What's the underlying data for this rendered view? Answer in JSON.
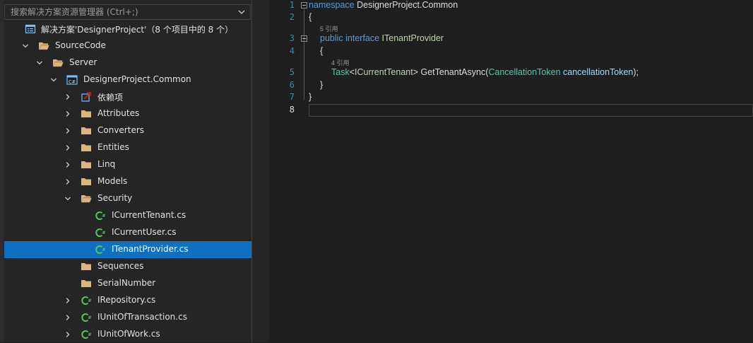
{
  "explorer": {
    "search_placeholder": "搜索解决方案资源管理器 (Ctrl+;)",
    "solution_label": "解决方案'DesignerProject'（8 个项目中的 8 个）",
    "items": [
      {
        "label": "SourceCode",
        "kind": "folder",
        "expanded": true
      },
      {
        "label": "Server",
        "kind": "folder",
        "expanded": true
      },
      {
        "label": "DesignerProject.Common",
        "kind": "csproj",
        "expanded": true
      },
      {
        "label": "依赖项",
        "kind": "dependencies",
        "expanded": false
      },
      {
        "label": "Attributes",
        "kind": "folder",
        "expanded": false
      },
      {
        "label": "Converters",
        "kind": "folder",
        "expanded": false
      },
      {
        "label": "Entities",
        "kind": "folder",
        "expanded": false
      },
      {
        "label": "Linq",
        "kind": "folder",
        "expanded": false
      },
      {
        "label": "Models",
        "kind": "folder",
        "expanded": false
      },
      {
        "label": "Security",
        "kind": "folder",
        "expanded": true
      },
      {
        "label": "ICurrentTenant.cs",
        "kind": "csfile"
      },
      {
        "label": "ICurrentUser.cs",
        "kind": "csfile"
      },
      {
        "label": "ITenantProvider.cs",
        "kind": "csfile",
        "selected": true
      },
      {
        "label": "Sequences",
        "kind": "folder"
      },
      {
        "label": "SerialNumber",
        "kind": "folder"
      },
      {
        "label": "IRepository.cs",
        "kind": "csfile",
        "expanded": false
      },
      {
        "label": "IUnitOfTransaction.cs",
        "kind": "csfile",
        "expanded": false
      },
      {
        "label": "IUnitOfWork.cs",
        "kind": "csfile",
        "expanded": false
      }
    ]
  },
  "editor": {
    "line_numbers": [
      "1",
      "2",
      "3",
      "4",
      "5",
      "6",
      "7",
      "8"
    ],
    "current_line": "8",
    "lines": {
      "l1_kw": "namespace",
      "l1_name": " DesignerProject.Common",
      "l2": "{",
      "l3_lens": "5 引用",
      "l3_kw": "public interface",
      "l3_name": " ITenantProvider",
      "l4": "{",
      "l5_lens": "4 引用",
      "l5_task": "Task",
      "l5_lt": "<",
      "l5_tenant": "ICurrentTenant",
      "l5_gt": ">",
      "l5_method": " GetTenantAsync(",
      "l5_ptype": "CancellationToken",
      "l5_pname": " cancellationToken",
      "l5_end": ");",
      "l6": "}",
      "l7": "}"
    }
  },
  "colors": {
    "selection": "#0e70c0",
    "keyword": "#569cd6",
    "type": "#4ec9b0",
    "interface": "#b8d7a3",
    "parameter": "#9cdcfe",
    "line_number": "#2b91af"
  }
}
